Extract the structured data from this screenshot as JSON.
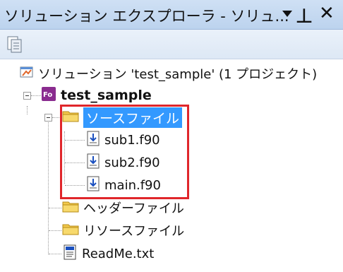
{
  "window": {
    "title": "ソリューション エクスプローラ - ソリュ..."
  },
  "tree": {
    "solution_label": "ソリューション 'test_sample' (1 プロジェクト)",
    "project_label": "test_sample",
    "source_folder": {
      "label": "ソースファイル",
      "files": [
        "sub1.f90",
        "sub2.f90",
        "main.f90"
      ]
    },
    "header_folder_label": "ヘッダーファイル",
    "resource_folder_label": "リソースファイル",
    "readme_label": "ReadMe.txt"
  },
  "colors": {
    "selection": "#3399ff",
    "highlight_box": "#e0262b",
    "titlebar": "#cfe0f4",
    "folder": "#f2c94c"
  }
}
